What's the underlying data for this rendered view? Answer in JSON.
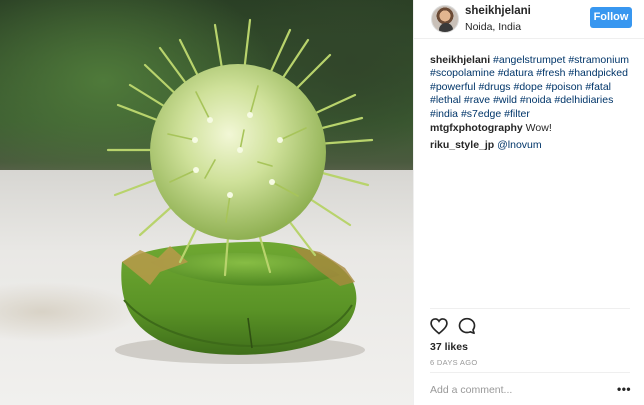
{
  "post": {
    "username": "sheikhjelani",
    "location": "Noida, India",
    "follow_label": "Follow"
  },
  "caption": {
    "username": "sheikhjelani",
    "hashtags": [
      "#angelstrumpet",
      "#stramonium",
      "#scopolamine",
      "#datura",
      "#fresh",
      "#handpicked",
      "#powerful",
      "#drugs",
      "#dope",
      "#poison",
      "#fatal",
      "#lethal",
      "#rave",
      "#wild",
      "#noida",
      "#delhidiaries",
      "#india",
      "#s7edge",
      "#filter"
    ]
  },
  "comments": [
    {
      "username": "mtgfxphotography",
      "text": "Wow!"
    },
    {
      "username": "riku_style_jp",
      "mention": "@lnovum"
    }
  ],
  "likes": "37 likes",
  "time": "6 DAYS AGO",
  "add_comment_placeholder": "Add a comment...",
  "more_label": "•••",
  "icons": {
    "like": "heart-icon",
    "comment": "speech-bubble-icon"
  },
  "colors": {
    "follow_button": "#3897f0",
    "hashtag": "#003569",
    "secondary_text": "#999999"
  }
}
